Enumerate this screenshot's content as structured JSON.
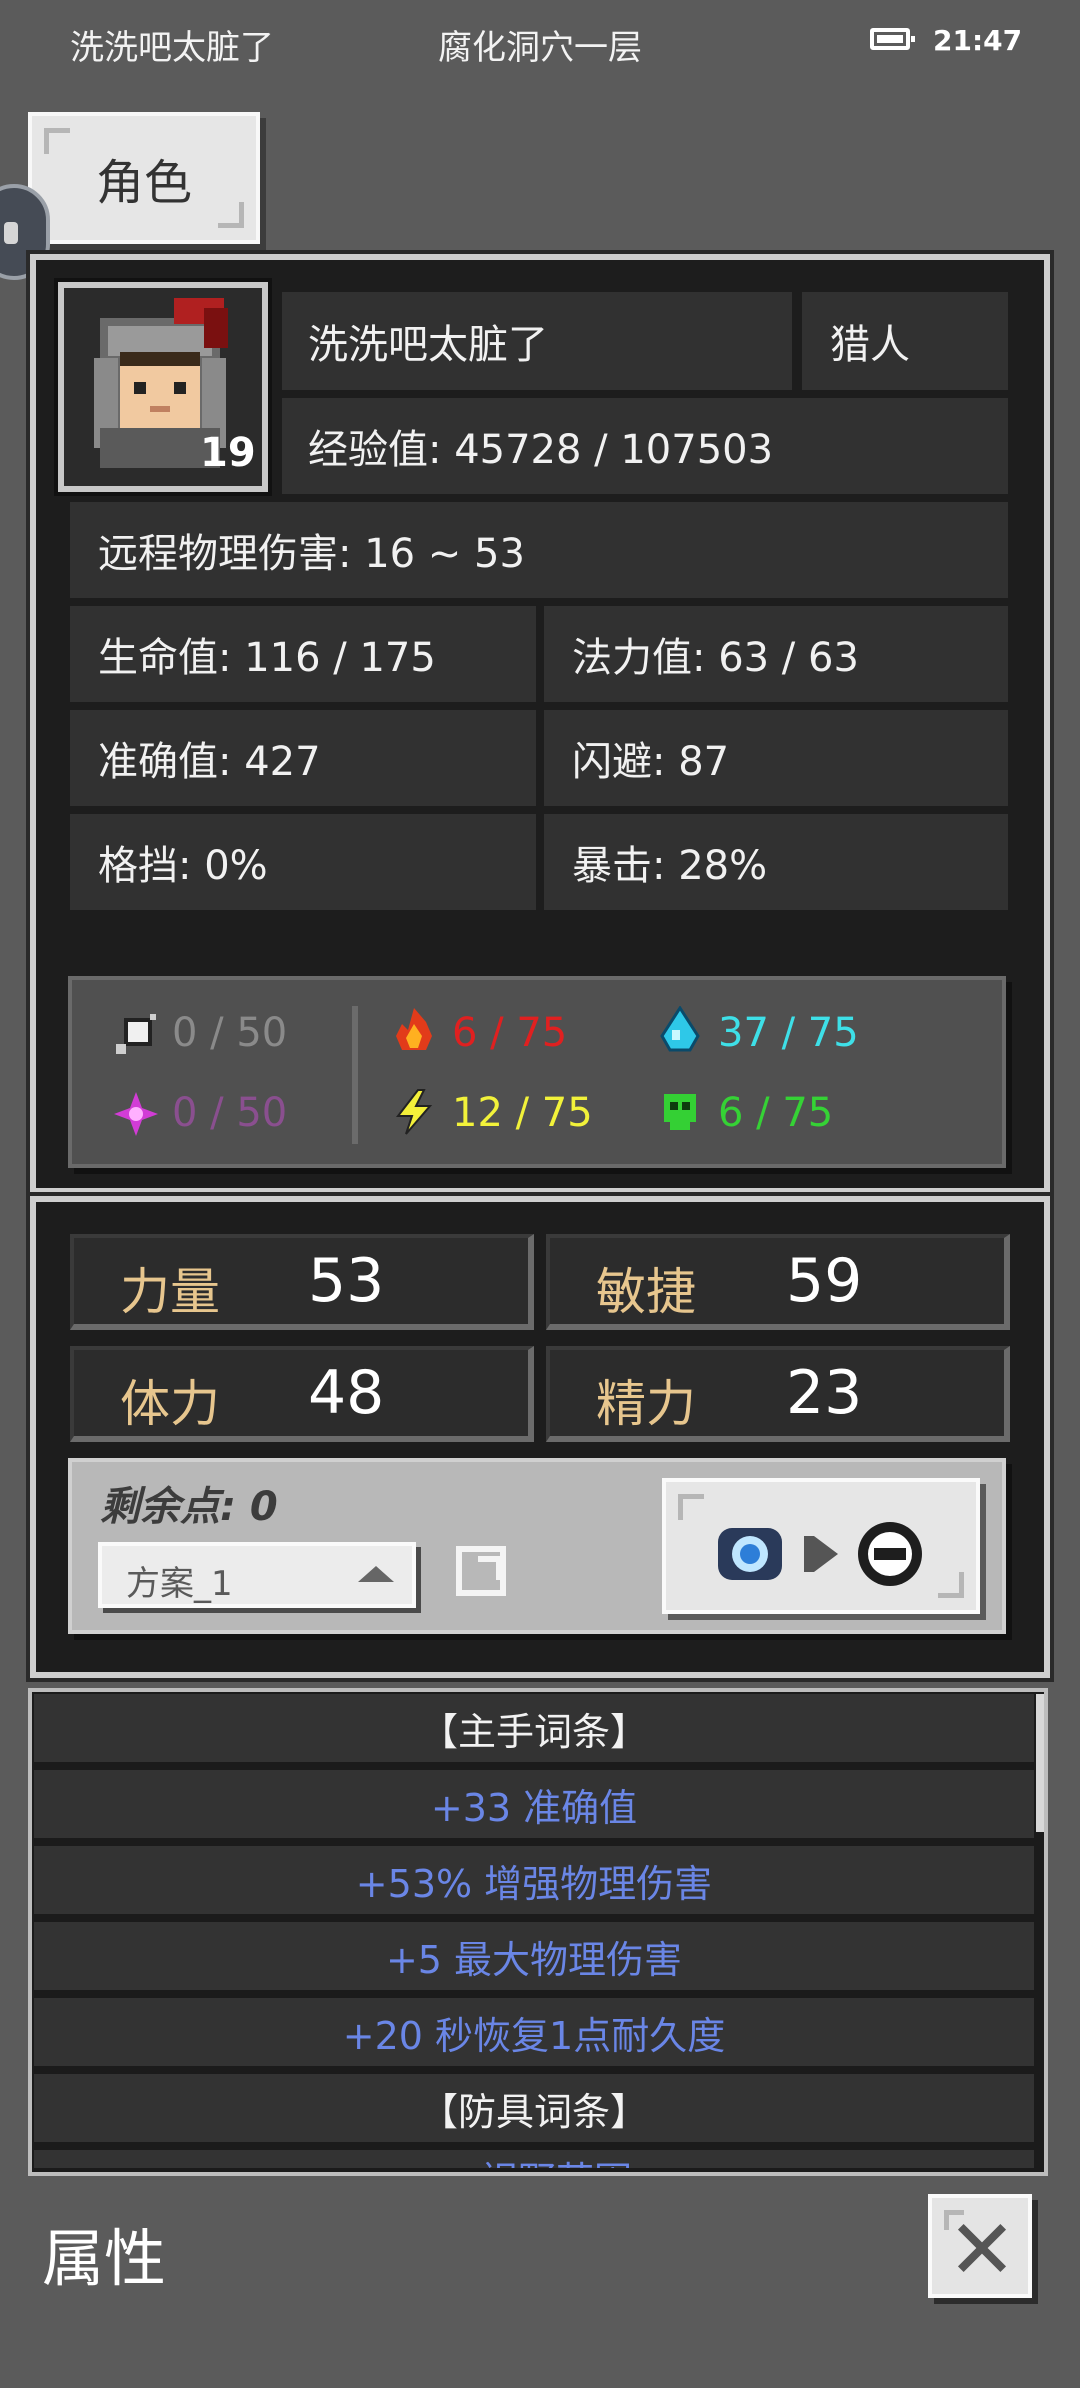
{
  "status_bar": {
    "player_name": "洗洗吧太脏了",
    "location": "腐化洞穴一层",
    "time": "21:47"
  },
  "tab": {
    "label": "角色"
  },
  "character": {
    "name": "洗洗吧太脏了",
    "class": "猎人",
    "level": "19",
    "experience": "经验值: 45728 / 107503",
    "damage": "远程物理伤害: 16 ~ 53",
    "hp": "生命值: 116 / 175",
    "mp": "法力值: 63 / 63",
    "accuracy": "准确值: 427",
    "evasion": "闪避: 87",
    "block": "格挡: 0%",
    "crit": "暴击: 28%"
  },
  "resistances": {
    "physical": {
      "value": "0 / 50",
      "color": "#8a8a8a",
      "icon": "sword-shield-icon"
    },
    "arcane": {
      "value": "0 / 50",
      "color": "#8a4f8f",
      "icon": "arcane-star-icon"
    },
    "fire": {
      "value": "6 / 75",
      "color": "#e02020",
      "icon": "fire-icon"
    },
    "lightning": {
      "value": "12 / 75",
      "color": "#f2f23a",
      "icon": "lightning-icon"
    },
    "water": {
      "value": "37 / 75",
      "color": "#3ee0e8",
      "icon": "water-drop-icon"
    },
    "poison": {
      "value": "6 / 75",
      "color": "#35d235",
      "icon": "poison-skull-icon"
    }
  },
  "attributes": {
    "strength": {
      "label": "力量",
      "value": "53"
    },
    "agility": {
      "label": "敏捷",
      "value": "59"
    },
    "stamina": {
      "label": "体力",
      "value": "48"
    },
    "energy": {
      "label": "精力",
      "value": "23"
    }
  },
  "points": {
    "remaining_label": "剩余点: 0",
    "scheme": "方案_1"
  },
  "affixes": {
    "rows": [
      {
        "text": "【主手词条】",
        "kind": "header"
      },
      {
        "text": "+33 准确值",
        "kind": "stat"
      },
      {
        "text": "+53% 增强物理伤害",
        "kind": "stat"
      },
      {
        "text": "+5 最大物理伤害",
        "kind": "stat"
      },
      {
        "text": "+20 秒恢复1点耐久度",
        "kind": "stat"
      },
      {
        "text": "【防具词条】",
        "kind": "header"
      },
      {
        "text": "+ 视野范围",
        "kind": "stat"
      }
    ]
  },
  "footer": {
    "title": "属性"
  },
  "colors": {
    "attr_label": "#e7c68e",
    "affix_stat": "#6a86e6",
    "panel_bg": "#1d1d1d"
  }
}
